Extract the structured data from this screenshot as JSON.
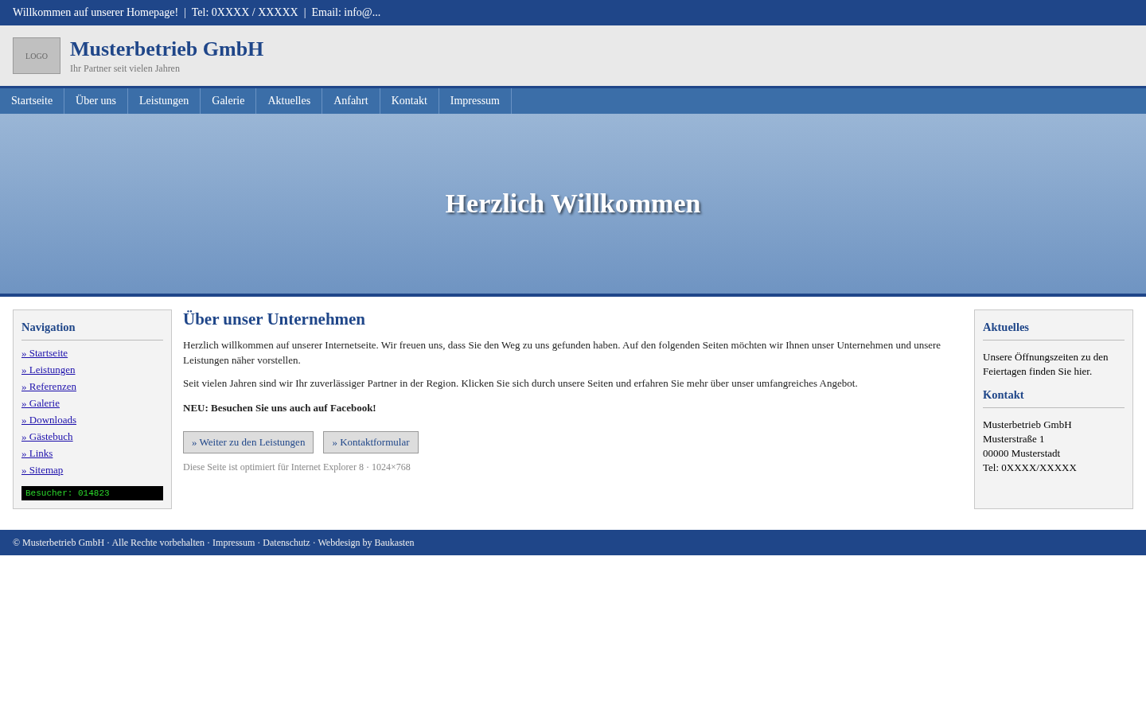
{
  "top_bar": {
    "text": "Willkommen auf unserer Homepage!  |  Tel: 0XXXX / XXXXX  |  Email: info@..."
  },
  "header": {
    "logo": "LOGO",
    "title": "Musterbetrieb GmbH",
    "subtitle": "Ihr Partner seit vielen Jahren"
  },
  "nav": {
    "items": [
      "Startseite",
      "Über uns",
      "Leistungen",
      "Galerie",
      "Aktuelles",
      "Anfahrt",
      "Kontakt",
      "Impressum"
    ]
  },
  "hero": {
    "title": "Herzlich Willkommen"
  },
  "sidebar": {
    "title": "Navigation",
    "links": [
      "» Startseite",
      "» Leistungen",
      "» Referenzen",
      "» Galerie",
      "» Downloads",
      "» Gästebuch",
      "» Links",
      "» Sitemap"
    ],
    "counter": "Besucher: 014823"
  },
  "content": {
    "title": "Über unser Unternehmen",
    "paragraphs": [
      "Herzlich willkommen auf unserer Internetseite. Wir freuen uns, dass Sie den Weg zu uns gefunden haben. Auf den folgenden Seiten möchten wir Ihnen unser Unternehmen und unsere Leistungen näher vorstellen.",
      "Seit vielen Jahren sind wir Ihr zuverlässiger Partner in der Region. Klicken Sie sich durch unsere Seiten und erfahren Sie mehr über unser umfangreiches Angebot."
    ],
    "notice": "NEU: Besuchen Sie uns auch auf Facebook!",
    "buttons": [
      "» Weiter zu den Leistungen",
      "» Kontaktformular"
    ],
    "note": "Diese Seite ist optimiert für Internet Explorer 8 · 1024×768"
  },
  "right_box": {
    "sections": [
      {
        "title": "Aktuelles",
        "lines": [
          "Unsere Öffnungszeiten zu den Feiertagen finden Sie hier."
        ]
      },
      {
        "title": "Kontakt",
        "lines": [
          "Musterbetrieb GmbH",
          "Musterstraße 1",
          "00000 Musterstadt",
          "Tel: 0XXXX/XXXXX"
        ]
      }
    ]
  },
  "footer": {
    "text": "© Musterbetrieb GmbH · Alle Rechte vorbehalten · Impressum · Datenschutz · Webdesign by Baukasten"
  }
}
